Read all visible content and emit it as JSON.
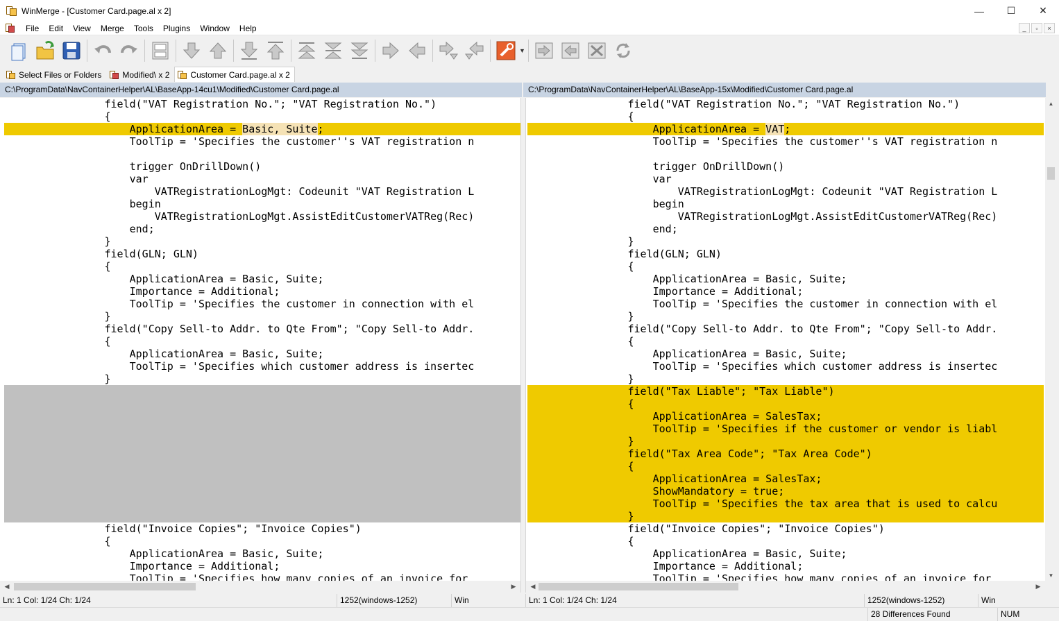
{
  "window": {
    "title": "WinMerge - [Customer Card.page.al x 2]",
    "controls": [
      "—",
      "☐",
      "✕"
    ]
  },
  "menu": [
    "File",
    "Edit",
    "View",
    "Merge",
    "Tools",
    "Plugins",
    "Window",
    "Help"
  ],
  "mdi_controls": [
    "_",
    "▫",
    "×"
  ],
  "toolbar": {
    "icons": [
      "new-icon",
      "open-icon",
      "save-icon",
      "undo-icon",
      "redo-icon",
      "compare-icon",
      "next-diff-icon",
      "prev-diff-icon",
      "first-diff-icon",
      "last-diff-icon",
      "current-diff-icon",
      "goto-icon",
      "all-diff-icon",
      "copy-right-icon",
      "copy-left-icon",
      "copy-right-advance-icon",
      "copy-left-advance-icon",
      "options-icon",
      "merge-all-right-icon",
      "merge-all-left-icon",
      "merge-icon",
      "refresh-icon"
    ]
  },
  "tabs": [
    {
      "label": "Select Files or Folders"
    },
    {
      "label": "Modified\\ x 2"
    },
    {
      "label": "Customer Card.page.al x 2"
    }
  ],
  "left": {
    "path": "C:\\ProgramData\\NavContainerHelper\\AL\\BaseApp-14cu1\\Modified\\Customer Card.page.al",
    "lines": [
      {
        "text": "                field(\"VAT Registration No.\"; \"VAT Registration No.\")",
        "type": "normal"
      },
      {
        "text": "                {",
        "type": "normal"
      },
      {
        "pre": "                    ApplicationArea = ",
        "hl": "Basic, Suite",
        "post": ";",
        "type": "diff-hl"
      },
      {
        "text": "                    ToolTip = 'Specifies the customer''s VAT registration n",
        "type": "normal"
      },
      {
        "text": "",
        "type": "normal"
      },
      {
        "text": "                    trigger OnDrillDown()",
        "type": "normal"
      },
      {
        "text": "                    var",
        "type": "normal"
      },
      {
        "text": "                        VATRegistrationLogMgt: Codeunit \"VAT Registration L",
        "type": "normal"
      },
      {
        "text": "                    begin",
        "type": "normal"
      },
      {
        "text": "                        VATRegistrationLogMgt.AssistEditCustomerVATReg(Rec)",
        "type": "normal"
      },
      {
        "text": "                    end;",
        "type": "normal"
      },
      {
        "text": "                }",
        "type": "normal"
      },
      {
        "text": "                field(GLN; GLN)",
        "type": "normal"
      },
      {
        "text": "                {",
        "type": "normal"
      },
      {
        "text": "                    ApplicationArea = Basic, Suite;",
        "type": "normal"
      },
      {
        "text": "                    Importance = Additional;",
        "type": "normal"
      },
      {
        "text": "                    ToolTip = 'Specifies the customer in connection with el",
        "type": "normal"
      },
      {
        "text": "                }",
        "type": "normal"
      },
      {
        "text": "                field(\"Copy Sell-to Addr. to Qte From\"; \"Copy Sell-to Addr.",
        "type": "normal"
      },
      {
        "text": "                {",
        "type": "normal"
      },
      {
        "text": "                    ApplicationArea = Basic, Suite;",
        "type": "normal"
      },
      {
        "text": "                    ToolTip = 'Specifies which customer address is insertec",
        "type": "normal"
      },
      {
        "text": "                }",
        "type": "normal"
      },
      {
        "text": "",
        "type": "ghost"
      },
      {
        "text": "",
        "type": "ghost"
      },
      {
        "text": "",
        "type": "ghost"
      },
      {
        "text": "",
        "type": "ghost"
      },
      {
        "text": "",
        "type": "ghost"
      },
      {
        "text": "",
        "type": "ghost"
      },
      {
        "text": "",
        "type": "ghost"
      },
      {
        "text": "",
        "type": "ghost"
      },
      {
        "text": "",
        "type": "ghost"
      },
      {
        "text": "",
        "type": "ghost"
      },
      {
        "text": "",
        "type": "ghost"
      },
      {
        "text": "                field(\"Invoice Copies\"; \"Invoice Copies\")",
        "type": "normal"
      },
      {
        "text": "                {",
        "type": "normal"
      },
      {
        "text": "                    ApplicationArea = Basic, Suite;",
        "type": "normal"
      },
      {
        "text": "                    Importance = Additional;",
        "type": "normal"
      },
      {
        "text": "                    ToolTip = 'Specifies how many copies of an invoice for",
        "type": "normal"
      }
    ]
  },
  "right": {
    "path": "C:\\ProgramData\\NavContainerHelper\\AL\\BaseApp-15x\\Modified\\Customer Card.page.al",
    "lines": [
      {
        "text": "                field(\"VAT Registration No.\"; \"VAT Registration No.\")",
        "type": "normal"
      },
      {
        "text": "                {",
        "type": "normal"
      },
      {
        "pre": "                    ApplicationArea = ",
        "hl": "VAT",
        "post": ";",
        "type": "diff-hl"
      },
      {
        "text": "                    ToolTip = 'Specifies the customer''s VAT registration n",
        "type": "normal"
      },
      {
        "text": "",
        "type": "normal"
      },
      {
        "text": "                    trigger OnDrillDown()",
        "type": "normal"
      },
      {
        "text": "                    var",
        "type": "normal"
      },
      {
        "text": "                        VATRegistrationLogMgt: Codeunit \"VAT Registration L",
        "type": "normal"
      },
      {
        "text": "                    begin",
        "type": "normal"
      },
      {
        "text": "                        VATRegistrationLogMgt.AssistEditCustomerVATReg(Rec)",
        "type": "normal"
      },
      {
        "text": "                    end;",
        "type": "normal"
      },
      {
        "text": "                }",
        "type": "normal"
      },
      {
        "text": "                field(GLN; GLN)",
        "type": "normal"
      },
      {
        "text": "                {",
        "type": "normal"
      },
      {
        "text": "                    ApplicationArea = Basic, Suite;",
        "type": "normal"
      },
      {
        "text": "                    Importance = Additional;",
        "type": "normal"
      },
      {
        "text": "                    ToolTip = 'Specifies the customer in connection with el",
        "type": "normal"
      },
      {
        "text": "                }",
        "type": "normal"
      },
      {
        "text": "                field(\"Copy Sell-to Addr. to Qte From\"; \"Copy Sell-to Addr.",
        "type": "normal"
      },
      {
        "text": "                {",
        "type": "normal"
      },
      {
        "text": "                    ApplicationArea = Basic, Suite;",
        "type": "normal"
      },
      {
        "text": "                    ToolTip = 'Specifies which customer address is insertec",
        "type": "normal"
      },
      {
        "text": "                }",
        "type": "normal"
      },
      {
        "text": "                field(\"Tax Liable\"; \"Tax Liable\")",
        "type": "diff"
      },
      {
        "text": "                {",
        "type": "diff"
      },
      {
        "text": "                    ApplicationArea = SalesTax;",
        "type": "diff"
      },
      {
        "text": "                    ToolTip = 'Specifies if the customer or vendor is liabl",
        "type": "diff"
      },
      {
        "text": "                }",
        "type": "diff"
      },
      {
        "text": "                field(\"Tax Area Code\"; \"Tax Area Code\")",
        "type": "diff"
      },
      {
        "text": "                {",
        "type": "diff"
      },
      {
        "text": "                    ApplicationArea = SalesTax;",
        "type": "diff"
      },
      {
        "text": "                    ShowMandatory = true;",
        "type": "diff"
      },
      {
        "text": "                    ToolTip = 'Specifies the tax area that is used to calcu",
        "type": "diff"
      },
      {
        "text": "                }",
        "type": "diff"
      },
      {
        "text": "                field(\"Invoice Copies\"; \"Invoice Copies\")",
        "type": "normal"
      },
      {
        "text": "                {",
        "type": "normal"
      },
      {
        "text": "                    ApplicationArea = Basic, Suite;",
        "type": "normal"
      },
      {
        "text": "                    Importance = Additional;",
        "type": "normal"
      },
      {
        "text": "                    ToolTip = 'Specifies how many copies of an invoice for",
        "type": "normal"
      }
    ]
  },
  "status": {
    "left": {
      "pos": "Ln: 1  Col: 1/24  Ch: 1/24",
      "encoding": "1252(windows-1252)",
      "eol": "Win"
    },
    "right": {
      "pos": "Ln: 1  Col: 1/24  Ch: 1/24",
      "encoding": "1252(windows-1252)",
      "eol": "Win"
    },
    "differences": "28 Differences Found",
    "num": "NUM"
  },
  "colors": {
    "diff": "#efca00",
    "ghost": "#c0c0c0",
    "word_highlight": "#f5e2b5",
    "path_header": "#c8d4e3"
  }
}
